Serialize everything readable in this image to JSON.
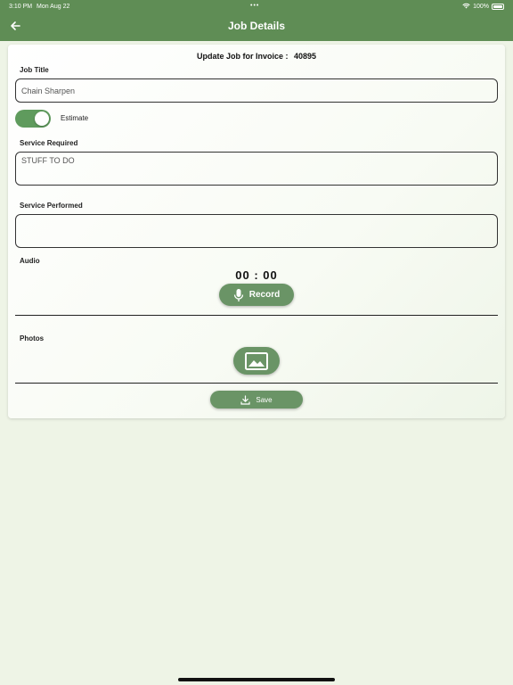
{
  "status_bar": {
    "time": "3:10 PM",
    "date": "Mon Aug 22",
    "dots": "•••",
    "battery": "100%"
  },
  "nav": {
    "title": "Job Details",
    "back_icon": "arrow-left-icon"
  },
  "invoice": {
    "label": "Update Job for Invoice :",
    "number": "40895"
  },
  "job_title": {
    "label": "Job Title",
    "value": "Chain Sharpen"
  },
  "estimate": {
    "label": "Estimate",
    "on": true
  },
  "service_required": {
    "label": "Service Required",
    "value": "STUFF TO DO"
  },
  "service_performed": {
    "label": "Service Performed",
    "value": ""
  },
  "audio": {
    "label": "Audio",
    "timer": "00 : 00",
    "record_label": "Record",
    "icon": "microphone-icon"
  },
  "photos": {
    "label": "Photos",
    "icon": "image-icon"
  },
  "save": {
    "label": "Save",
    "icon": "download-icon"
  },
  "colors": {
    "header": "#5f8d55",
    "accent": "#6a9466",
    "background": "#eef4e6"
  }
}
